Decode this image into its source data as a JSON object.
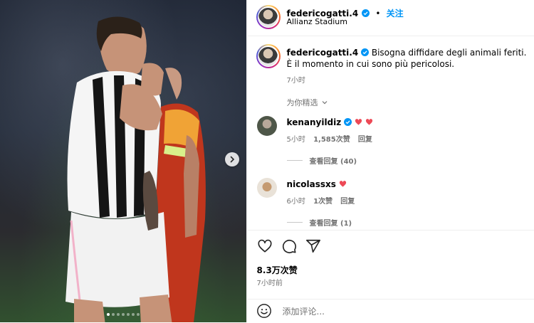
{
  "post": {
    "username": "federicogatti.4",
    "follow_label": "关注",
    "separator": "•",
    "location": "Allianz Stadium",
    "media": {
      "slide_count": 7,
      "active_slide": 1
    }
  },
  "caption": {
    "username": "federicogatti.4",
    "line1": "Bisogna diffidare degli animali feriti.",
    "line2": "È il momento in cui sono più pericolosi.",
    "time": "7小时",
    "translate_label": "为你精选"
  },
  "comments": [
    {
      "username": "kenanyildiz",
      "verified": true,
      "hearts": 2,
      "time": "5小时",
      "likes": "1,585次赞",
      "reply_label": "回复",
      "view_replies": "查看回复 (40)"
    },
    {
      "username": "nicolassxs",
      "verified": false,
      "hearts": 1,
      "time": "6小时",
      "likes": "1次赞",
      "reply_label": "回复",
      "view_replies": "查看回复 (1)"
    }
  ],
  "actions": {
    "icons": [
      "heart-icon",
      "comment-icon",
      "share-icon"
    ],
    "likes_text": "8.3万次赞",
    "post_time": "7小时前"
  },
  "add_comment": {
    "placeholder": "添加评论..."
  },
  "colors": {
    "accent": "#0095f6",
    "heart": "#ed4956",
    "muted": "#737373"
  }
}
